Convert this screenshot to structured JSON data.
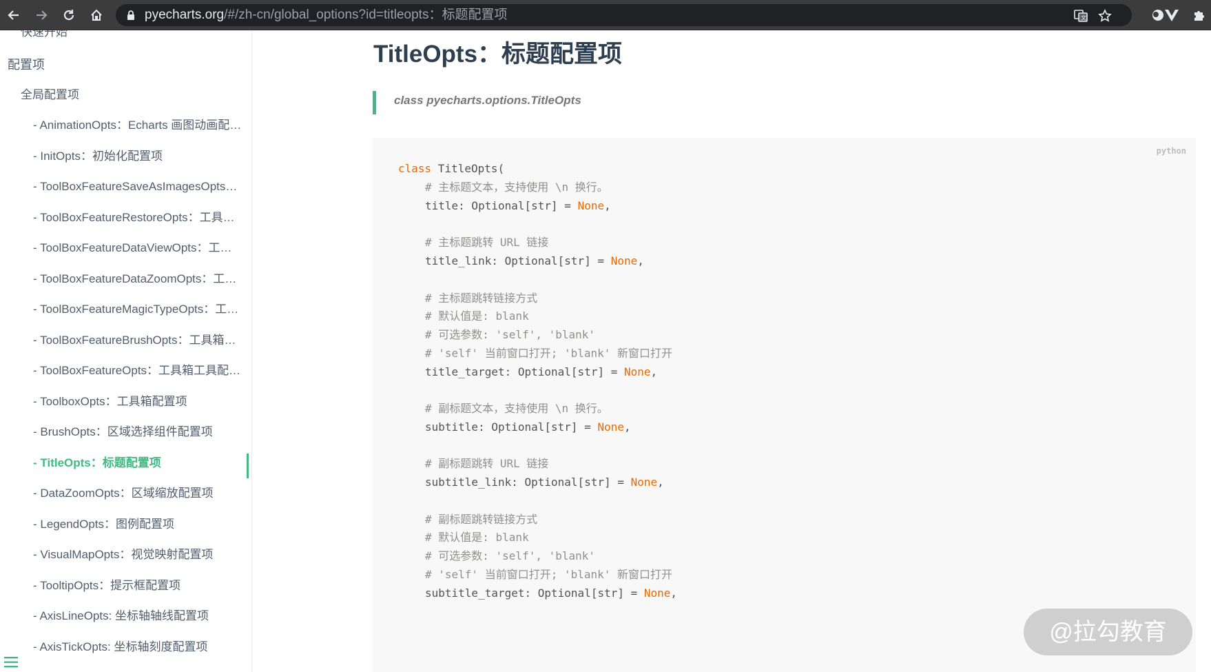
{
  "browser": {
    "url_domain": "pyecharts.org",
    "url_rest": "/#/zh-cn/global_options?id=titleopts：标题配置项",
    "icons": [
      "back-icon",
      "forward-icon",
      "reload-icon",
      "home-icon",
      "lock-icon",
      "translate-icon",
      "star-icon",
      "extension-icon",
      "vue-devtools-icon",
      "puzzle-icon"
    ]
  },
  "sidebar": {
    "items": [
      {
        "label": "快速开始"
      },
      {
        "label": "配置项"
      },
      {
        "label": "全局配置项"
      },
      {
        "label": "- AnimationOpts：Echarts 画图动画配置项"
      },
      {
        "label": "- InitOpts：初始化配置项"
      },
      {
        "label": "- ToolBoxFeatureSaveAsImagesOpts：工具箱保存图片配置项"
      },
      {
        "label": "- ToolBoxFeatureRestoreOpts：工具箱还原配置项"
      },
      {
        "label": "- ToolBoxFeatureDataViewOpts：工具箱数据视图工具"
      },
      {
        "label": "- ToolBoxFeatureDataZoomOpts：工具箱区域缩放配置项"
      },
      {
        "label": "- ToolBoxFeatureMagicTypeOpts：工具箱动态类型切换配置项"
      },
      {
        "label": "- ToolBoxFeatureBrushOpts：工具箱选框组件配置项"
      },
      {
        "label": "- ToolBoxFeatureOpts：工具箱工具配置项"
      },
      {
        "label": "- ToolboxOpts：工具箱配置项"
      },
      {
        "label": "- BrushOpts：区域选择组件配置项"
      },
      {
        "label": "- TitleOpts：标题配置项"
      },
      {
        "label": "- DataZoomOpts：区域缩放配置项"
      },
      {
        "label": "- LegendOpts：图例配置项"
      },
      {
        "label": "- VisualMapOpts：视觉映射配置项"
      },
      {
        "label": "- TooltipOpts：提示框配置项"
      },
      {
        "label": "- AxisLineOpts: 坐标轴轴线配置项"
      },
      {
        "label": "- AxisTickOpts: 坐标轴刻度配置项"
      }
    ],
    "active_label": "- TitleOpts：标题配置项"
  },
  "main": {
    "title": "TitleOpts：标题配置项",
    "blockquote": "class pyecharts.options.TitleOpts",
    "code_lang": "python",
    "code": {
      "l0": "class",
      "l0b": " TitleOpts(",
      "c1": "# 主标题文本，支持使用 \\n 换行。",
      "a1": "title: Optional[str] = ",
      "c2": "# 主标题跳转 URL 链接",
      "a2": "title_link: Optional[str] = ",
      "c3": "# 主标题跳转链接方式",
      "c4": "# 默认值是: blank",
      "c5": "# 可选参数: 'self', 'blank'",
      "c6": "# 'self' 当前窗口打开; 'blank' 新窗口打开",
      "a3": "title_target: Optional[str] = ",
      "c7": "# 副标题文本，支持使用 \\n 换行。",
      "a4": "subtitle: Optional[str] = ",
      "c8": "# 副标题跳转 URL 链接",
      "a5": "subtitle_link: Optional[str] = ",
      "c9": "# 副标题跳转链接方式",
      "c10": "# 默认值是: blank",
      "c11": "# 可选参数: 'self', 'blank'",
      "c12": "# 'self' 当前窗口打开; 'blank' 新窗口打开",
      "a6": "subtitle_target: Optional[str] = ",
      "none": "None",
      "comma": ","
    }
  },
  "watermark": "@拉勾教育"
}
